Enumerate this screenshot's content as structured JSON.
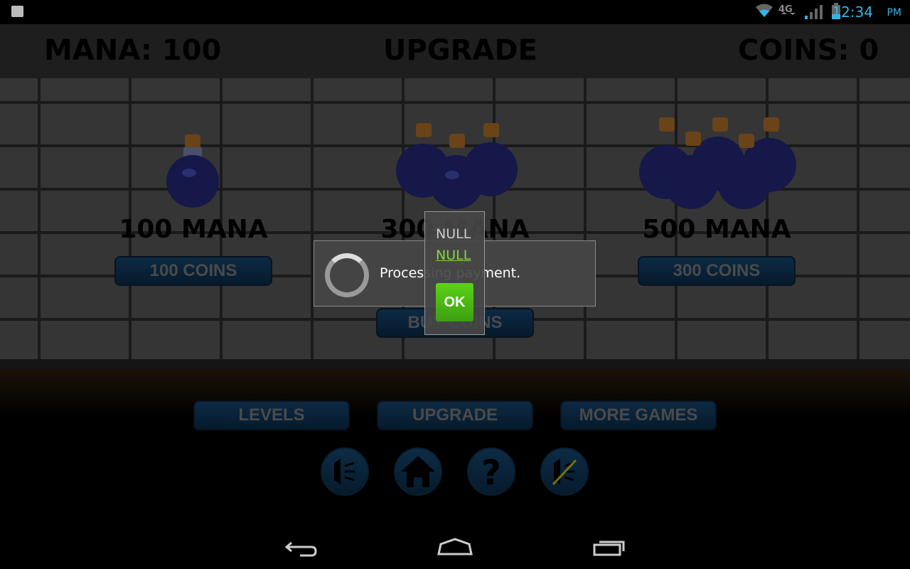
{
  "status_bar": {
    "time": "12:34",
    "ampm": "PM",
    "icons": [
      "shopping-bag-icon",
      "wifi-icon",
      "4g-lte-icon",
      "signal-icon",
      "battery-icon"
    ]
  },
  "header": {
    "mana": "MANA: 100",
    "title": "UPGRADE",
    "coins": "COINS: 0"
  },
  "offers": [
    {
      "label": "100 MANA",
      "button": "100 COINS"
    },
    {
      "label": "300 MANA",
      "button": "BUY COINS"
    },
    {
      "label": "500 MANA",
      "button": "300 COINS"
    }
  ],
  "menu": {
    "levels": "LEVELS",
    "upgrade": "UPGRADE",
    "more_games": "MORE GAMES"
  },
  "icon_buttons": [
    "sound-on-icon",
    "home-icon",
    "help-icon",
    "sound-off-icon"
  ],
  "dialog": {
    "message": "Processing payment."
  },
  "popup": {
    "line1": "NULL",
    "link": "NULL",
    "ok": "OK"
  },
  "colors": {
    "status_accent": "#33b5e5",
    "ok_green": "#5ad314",
    "link_green": "#7ed93a"
  }
}
